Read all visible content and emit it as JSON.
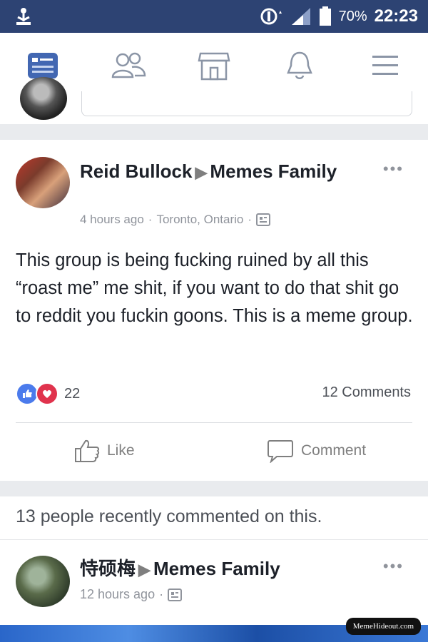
{
  "status_bar": {
    "battery_percent": "70%",
    "time": "22:23"
  },
  "nav": {
    "items": [
      {
        "icon": "news-feed-icon",
        "active": true
      },
      {
        "icon": "friends-icon",
        "active": false
      },
      {
        "icon": "marketplace-icon",
        "active": false
      },
      {
        "icon": "notifications-bell-icon",
        "active": false
      },
      {
        "icon": "menu-icon",
        "active": false
      }
    ]
  },
  "post": {
    "author": "Reid Bullock",
    "group": "Memes Family",
    "time": "4 hours ago",
    "location": "Toronto, Ontario",
    "text": "This group is being fucking ruined by all this “roast me” me shit, if you want to do that shit go to reddit you fuckin goons. This is a meme group.",
    "reaction_count": "22",
    "comments_count": "12 Comments",
    "like_label": "Like",
    "comment_label": "Comment"
  },
  "recent_activity": "13 people recently commented on this.",
  "post2": {
    "author": "恃硕梅",
    "group": "Memes Family",
    "time": "12 hours ago"
  },
  "watermark": "MemeHideout.com",
  "colors": {
    "status_bar": "#2d4373",
    "like_blue": "#4b7bec",
    "love_red": "#e0334d",
    "nav_active": "#4267b2"
  }
}
